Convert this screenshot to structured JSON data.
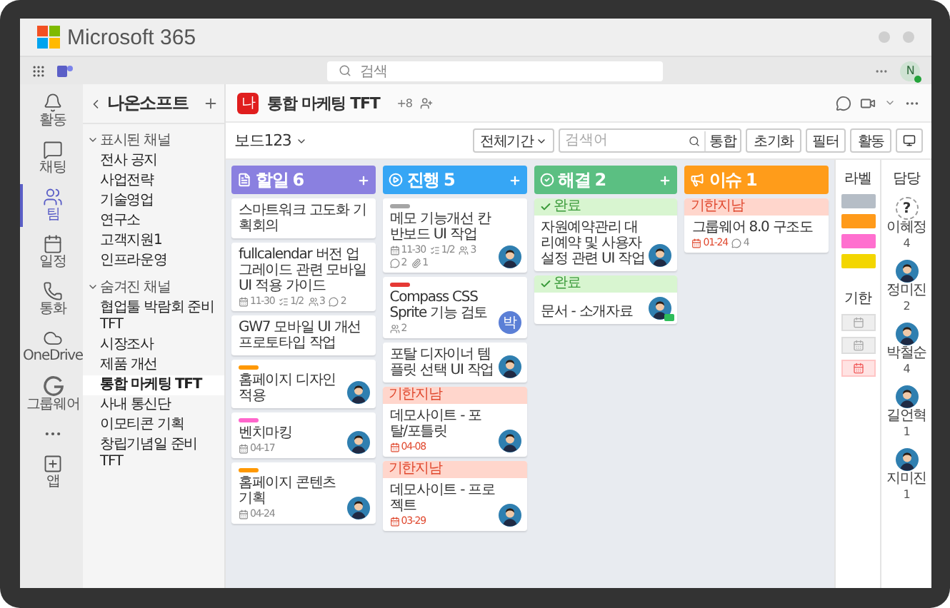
{
  "window": {
    "title": "Microsoft 365"
  },
  "app_bar": {
    "search_placeholder": "검색",
    "user_initial": "N"
  },
  "rail": [
    {
      "label": "활동",
      "kind": "bell",
      "selected": false
    },
    {
      "label": "채팅",
      "kind": "chat",
      "selected": false
    },
    {
      "label": "팀",
      "kind": "teams",
      "selected": true
    },
    {
      "label": "일정",
      "kind": "calendar",
      "selected": false
    },
    {
      "label": "통화",
      "kind": "call",
      "selected": false
    },
    {
      "label": "OneDrive",
      "kind": "cloud",
      "selected": false
    },
    {
      "label": "그룹웨어",
      "kind": "groupware",
      "selected": false
    },
    {
      "kind": "more",
      "selected": false
    },
    {
      "label": "앱",
      "kind": "apps",
      "selected": false
    }
  ],
  "team": {
    "name": "나온소프트",
    "groups": [
      {
        "title": "표시된 채널",
        "expanded": true,
        "channels": [
          {
            "name": "전사 공지",
            "selected": false
          },
          {
            "name": "사업전략",
            "selected": false
          },
          {
            "name": "기술영업",
            "selected": false
          },
          {
            "name": "연구소",
            "selected": false
          },
          {
            "name": "고객지원1",
            "selected": false
          },
          {
            "name": "인프라운영",
            "selected": false
          }
        ]
      },
      {
        "title": "숨겨진 채널",
        "expanded": true,
        "channels": [
          {
            "name": "협업툴 박람회 준비 TFT",
            "selected": false
          },
          {
            "name": "시장조사",
            "selected": false
          },
          {
            "name": "제품 개선",
            "selected": false
          },
          {
            "name": "통합 마케팅 TFT",
            "selected": true
          },
          {
            "name": "사내 통신단",
            "selected": false
          },
          {
            "name": "이모티콘 기획",
            "selected": false
          },
          {
            "name": "창립기념일 준비 TFT",
            "selected": false
          }
        ]
      }
    ]
  },
  "channel": {
    "badge": "나",
    "name": "통합 마케팅 TFT",
    "members": "+8"
  },
  "board": {
    "name": "보드123",
    "period": "전체기간",
    "search_placeholder": "검색어",
    "scope": "통합",
    "buttons": [
      "초기화",
      "필터",
      "활동"
    ]
  },
  "columns": [
    {
      "title": "할일",
      "count": "6",
      "kind": "todo",
      "color": "#8a80e0",
      "addable": true,
      "cards": [
        {
          "title": "스마트워크 고도화 기획회의"
        },
        {
          "title": "fullcalendar 버전 업그레이드 관련 모바일 UI 적용 가이드",
          "meta": {
            "due": "11-30",
            "overdue": false,
            "checklist": "1/2",
            "people": "3",
            "comments": "2"
          }
        },
        {
          "title": "GW7 모바일 UI 개선 프로토타입 작업"
        },
        {
          "label": {
            "color": "#ff9800"
          },
          "title": "홈페이지 디자인 적용",
          "assignee": {
            "kind": "photo"
          }
        },
        {
          "label": {
            "color": "#ff66cc"
          },
          "title": "벤치마킹",
          "meta": {
            "due": "04-17",
            "overdue": false
          },
          "assignee": {
            "kind": "photo"
          }
        },
        {
          "label": {
            "color": "#ff9800"
          },
          "title": "홈페이지 콘텐츠 기획",
          "meta": {
            "due": "04-24",
            "overdue": false
          },
          "assignee": {
            "kind": "photo"
          }
        }
      ]
    },
    {
      "title": "진행",
      "count": "5",
      "kind": "progress",
      "color": "#36a6f5",
      "addable": true,
      "cards": [
        {
          "label": {
            "color": "#a5a5a5"
          },
          "title": "메모 기능개선 칸반보드 UI 작업",
          "meta": {
            "due": "11-30",
            "overdue": false,
            "checklist": "1/2",
            "people": "3",
            "comments": "2",
            "attachments": "1"
          },
          "assignee": {
            "kind": "photo"
          }
        },
        {
          "label": {
            "color": "#e53935"
          },
          "title": "Compass CSS Sprite 기능 검토",
          "meta": {
            "people": "2"
          },
          "assignee": {
            "kind": "initial",
            "text": "박"
          }
        },
        {
          "title": "포탈 디자이너 템플릿 선택 UI 작업",
          "assignee": {
            "kind": "photo"
          }
        },
        {
          "flag": {
            "kind": "overdue",
            "text": "기한지남"
          },
          "title": "데모사이트 - 포탈/포틀릿",
          "meta": {
            "due": "04-08",
            "overdue": true
          },
          "assignee": {
            "kind": "photo"
          }
        },
        {
          "flag": {
            "kind": "overdue",
            "text": "기한지남"
          },
          "title": "데모사이트 - 프로젝트",
          "meta": {
            "due": "03-29",
            "overdue": true
          },
          "assignee": {
            "kind": "photo"
          }
        }
      ]
    },
    {
      "title": "해결",
      "count": "2",
      "kind": "done",
      "color": "#5bbf82",
      "addable": true,
      "cards": [
        {
          "flag": {
            "kind": "done",
            "text": "완료"
          },
          "title": "자원예약관리 대리예약 및 사용자 설정 관련 UI 작업",
          "assignee": {
            "kind": "photo"
          }
        },
        {
          "flag": {
            "kind": "done",
            "text": "완료"
          },
          "title": "문서 - 소개자료",
          "assignee": {
            "kind": "photo",
            "badge": true
          }
        }
      ]
    },
    {
      "title": "이슈",
      "count": "1",
      "kind": "issue",
      "color": "#ff9c1a",
      "addable": false,
      "cards": [
        {
          "flag": {
            "kind": "overdue",
            "text": "기한지남"
          },
          "title": "그룹웨어 8.0 구조도",
          "meta": {
            "due": "01-24",
            "overdue": true,
            "comments": "4"
          }
        }
      ]
    }
  ],
  "labels": {
    "title": "라벨",
    "items": [
      {
        "color": "#b5bdc6"
      },
      {
        "color": "#ff9a1a"
      },
      {
        "color": "#ff6fcf"
      },
      {
        "color": "#f3d600"
      }
    ]
  },
  "due_filter": {
    "title": "기한",
    "items": [
      {
        "kind": "none"
      },
      {
        "kind": "upcoming"
      },
      {
        "kind": "overdue"
      }
    ]
  },
  "assignees": {
    "title": "담당",
    "people": [
      {
        "name": "이혜정",
        "count": "4",
        "kind": "unassigned",
        "avatar_text": "?"
      },
      {
        "name": "정미진",
        "count": "2",
        "kind": "photo"
      },
      {
        "name": "박철순",
        "count": "4",
        "kind": "photo"
      },
      {
        "name": "길언혁",
        "count": "1",
        "kind": "photo"
      },
      {
        "name": "지미진",
        "count": "1",
        "kind": "photo"
      }
    ]
  }
}
